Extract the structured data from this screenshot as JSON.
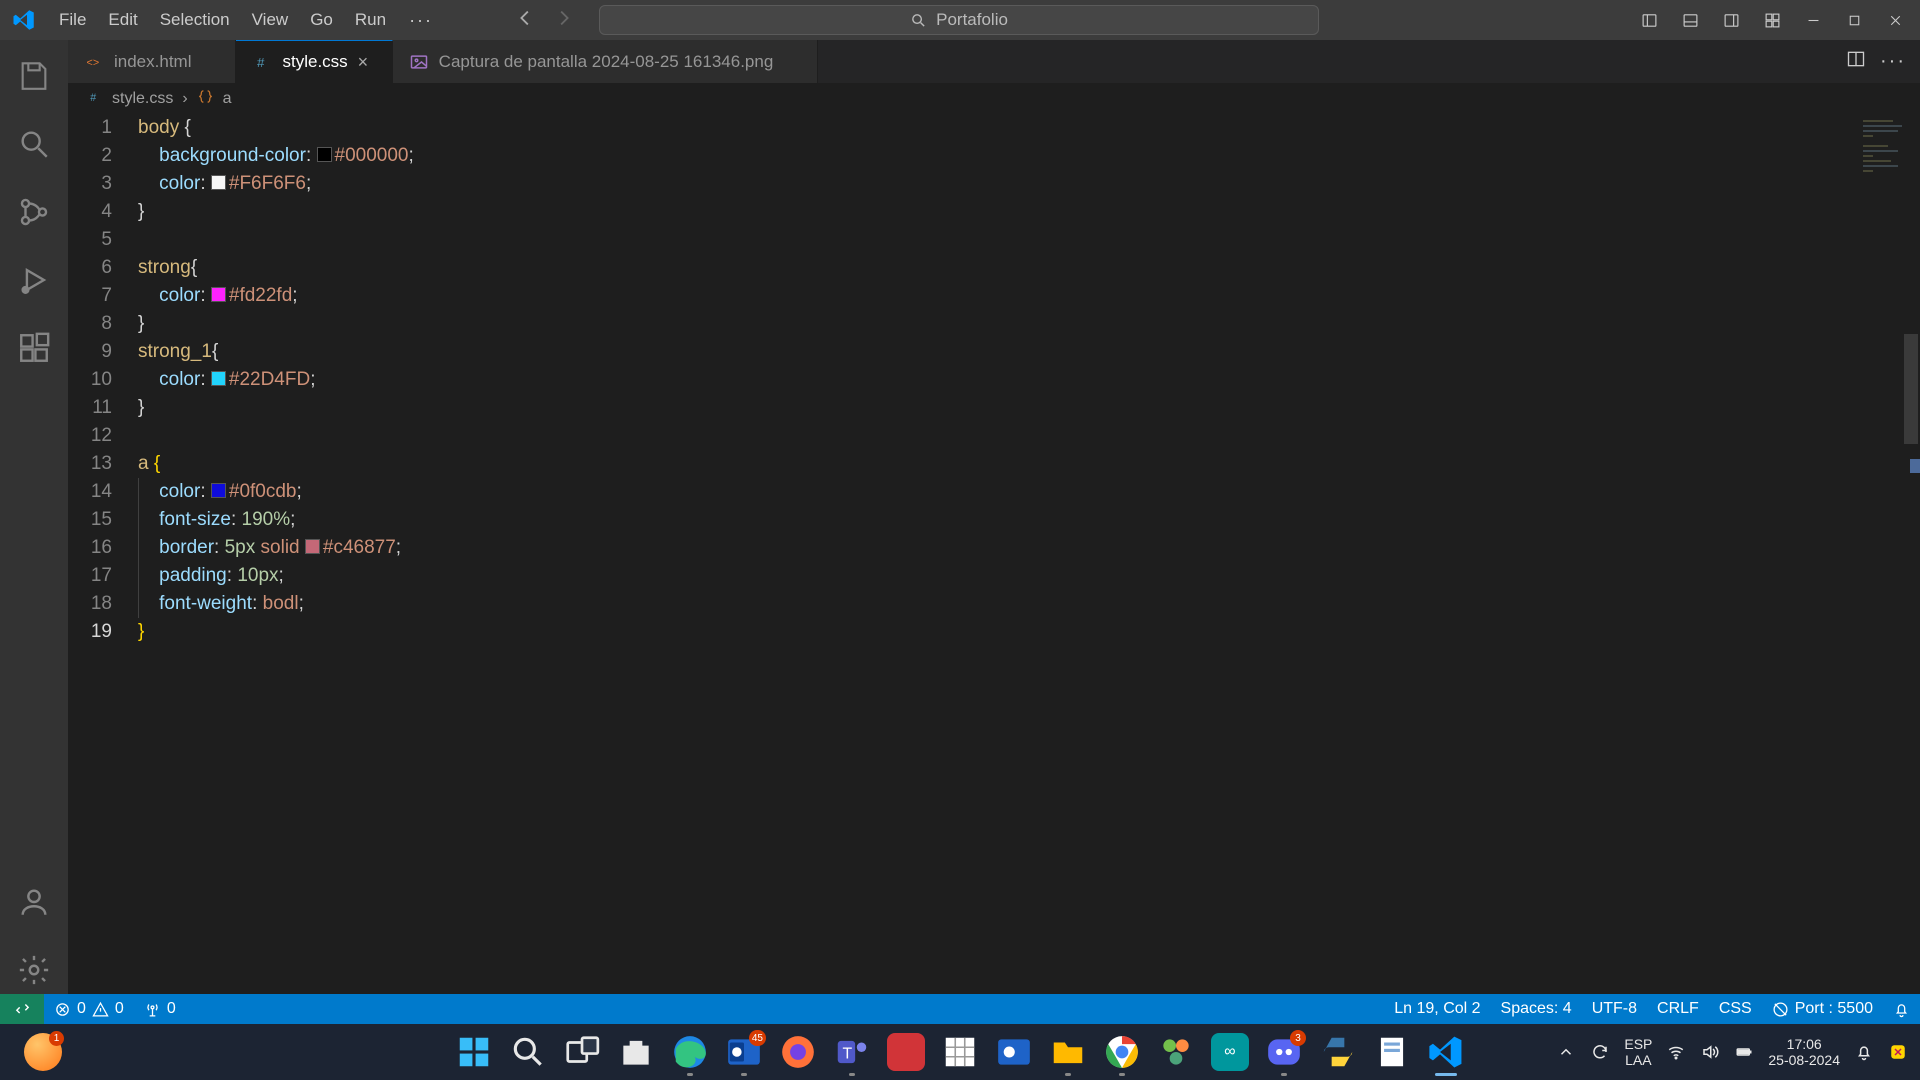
{
  "menu": {
    "file": "File",
    "edit": "Edit",
    "selection": "Selection",
    "view": "View",
    "go": "Go",
    "run": "Run",
    "more": "···"
  },
  "command_center": {
    "placeholder": "Portafolio"
  },
  "tabs": [
    {
      "label": "index.html"
    },
    {
      "label": "style.css"
    },
    {
      "label": "Captura de pantalla 2024-08-25 161346.png"
    }
  ],
  "tabs_actions_more": "···",
  "breadcrumb": {
    "file": "style.css",
    "sep": "›",
    "symbol": "a"
  },
  "status": {
    "errors_icon_val": "0",
    "warnings_icon_val": "0",
    "ports_val": "0",
    "ln_col": "Ln 19, Col 2",
    "spaces": "Spaces: 4",
    "encoding": "UTF-8",
    "eol": "CRLF",
    "lang": "CSS",
    "port": "Port : 5500"
  },
  "code": {
    "lines": [
      {
        "n": "1",
        "sel": "body",
        "after_sel": " ",
        "brace_open": true
      },
      {
        "n": "2",
        "indent": 1,
        "prop": "background-color",
        "swatch": "#000000",
        "hex": "#000000"
      },
      {
        "n": "3",
        "indent": 1,
        "prop": "color",
        "swatch": "#F6F6F6",
        "hex": "#F6F6F6"
      },
      {
        "n": "4",
        "brace_close": true
      },
      {
        "n": "5",
        "blank": true
      },
      {
        "n": "6",
        "sel": "strong",
        "brace_open": true
      },
      {
        "n": "7",
        "indent": 1,
        "prop": "color",
        "swatch": "#fd22fd",
        "hex": "#fd22fd"
      },
      {
        "n": "8",
        "brace_close": true
      },
      {
        "n": "9",
        "sel": "strong_1",
        "brace_open": true
      },
      {
        "n": "10",
        "indent": 1,
        "prop": "color",
        "swatch": "#22D4FD",
        "hex": "#22D4FD"
      },
      {
        "n": "11",
        "brace_close": true
      },
      {
        "n": "12",
        "blank": true
      },
      {
        "n": "13",
        "sel": "a",
        "after_sel": " ",
        "brace_open": true,
        "brace_yellow": true
      },
      {
        "n": "14",
        "indent": 1,
        "guide": true,
        "prop": "color",
        "swatch": "#0f0cdb",
        "hex": "#0f0cdb"
      },
      {
        "n": "15",
        "indent": 1,
        "guide": true,
        "prop": "font-size",
        "num": "190%"
      },
      {
        "n": "16",
        "indent": 1,
        "guide": true,
        "prop": "border",
        "border": true,
        "num1": "5px",
        "kw": "solid",
        "swatch": "#c46877",
        "hex": "#c46877"
      },
      {
        "n": "17",
        "indent": 1,
        "guide": true,
        "prop": "padding",
        "num": "10px"
      },
      {
        "n": "18",
        "indent": 1,
        "guide": true,
        "prop": "font-weight",
        "val": "bodl"
      },
      {
        "n": "19",
        "brace_close": true,
        "brace_yellow": true,
        "current": true
      }
    ]
  },
  "taskbar": {
    "orange_badge": "1",
    "outlook_badge": "45",
    "discord_badge": "3",
    "lang1": "ESP",
    "lang2": "LAA",
    "time": "17:06",
    "date": "25-08-2024"
  }
}
